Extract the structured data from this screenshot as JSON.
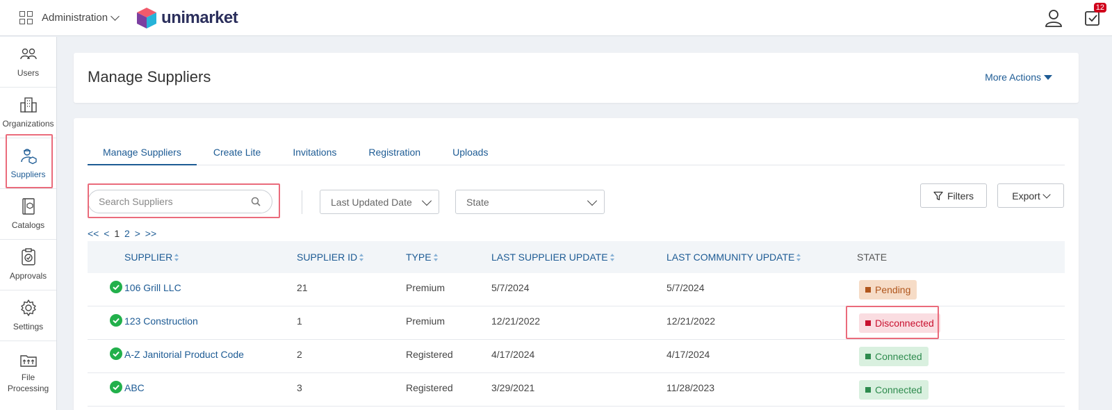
{
  "header": {
    "app_switcher_label": "Administration",
    "logo_text": "unimarket",
    "tasks_count": "12"
  },
  "sidebar": {
    "items": [
      {
        "label": "Users",
        "icon": "users-icon"
      },
      {
        "label": "Organizations",
        "icon": "building-icon"
      },
      {
        "label": "Suppliers",
        "icon": "supplier-icon"
      },
      {
        "label": "Catalogs",
        "icon": "catalog-icon"
      },
      {
        "label": "Approvals",
        "icon": "approval-icon"
      },
      {
        "label": "Settings",
        "icon": "gear-icon"
      },
      {
        "label": "File Processing",
        "icon": "folder-icon"
      }
    ],
    "active": "Suppliers"
  },
  "page": {
    "title": "Manage Suppliers",
    "more_actions": "More Actions"
  },
  "tabs": [
    "Manage Suppliers",
    "Create Lite",
    "Invitations",
    "Registration",
    "Uploads"
  ],
  "toolbar": {
    "search_placeholder": "Search Suppliers",
    "last_updated_label": "Last Updated Date",
    "state_label": "State",
    "filters_label": "Filters",
    "export_label": "Export"
  },
  "pager": {
    "first": "<<",
    "prev": "<",
    "pages": [
      "1",
      "2"
    ],
    "next": ">",
    "last": ">>"
  },
  "table": {
    "columns": [
      "SUPPLIER",
      "SUPPLIER ID",
      "TYPE",
      "LAST SUPPLIER UPDATE",
      "LAST COMMUNITY UPDATE",
      "STATE"
    ],
    "rows": [
      {
        "supplier": "106 Grill LLC",
        "id": "21",
        "type": "Premium",
        "supplier_update": "5/7/2024",
        "community_update": "5/7/2024",
        "state": "Pending"
      },
      {
        "supplier": "123 Construction",
        "id": "1",
        "type": "Premium",
        "supplier_update": "12/21/2022",
        "community_update": "12/21/2022",
        "state": "Disconnected"
      },
      {
        "supplier": "A-Z Janitorial Product Code",
        "id": "2",
        "type": "Registered",
        "supplier_update": "4/17/2024",
        "community_update": "4/17/2024",
        "state": "Connected"
      },
      {
        "supplier": "ABC",
        "id": "3",
        "type": "Registered",
        "supplier_update": "3/29/2021",
        "community_update": "11/28/2023",
        "state": "Connected"
      }
    ]
  },
  "colors": {
    "accent": "#1d5b94",
    "highlight": "#ea6b7b",
    "pending": "#b0561c",
    "disconnected": "#c8102e",
    "connected": "#2e8b4e"
  }
}
